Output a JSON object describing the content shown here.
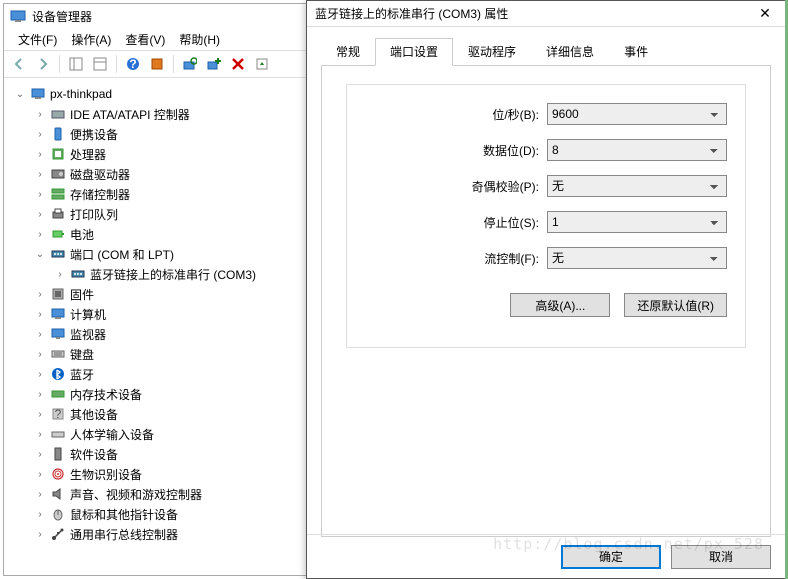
{
  "dm": {
    "title": "设备管理器",
    "menu": {
      "file": "文件(F)",
      "action": "操作(A)",
      "view": "查看(V)",
      "help": "帮助(H)"
    },
    "root": "px-thinkpad",
    "nodes": [
      {
        "label": "IDE ATA/ATAPI 控制器",
        "icon": "ide"
      },
      {
        "label": "便携设备",
        "icon": "portable"
      },
      {
        "label": "处理器",
        "icon": "cpu"
      },
      {
        "label": "磁盘驱动器",
        "icon": "disk"
      },
      {
        "label": "存储控制器",
        "icon": "storage"
      },
      {
        "label": "打印队列",
        "icon": "print"
      },
      {
        "label": "电池",
        "icon": "battery"
      },
      {
        "label": "端口 (COM 和 LPT)",
        "icon": "port",
        "expanded": true,
        "children": [
          {
            "label": "蓝牙链接上的标准串行 (COM3)",
            "icon": "port"
          }
        ]
      },
      {
        "label": "固件",
        "icon": "firmware"
      },
      {
        "label": "计算机",
        "icon": "computer"
      },
      {
        "label": "监视器",
        "icon": "monitor"
      },
      {
        "label": "键盘",
        "icon": "keyboard"
      },
      {
        "label": "蓝牙",
        "icon": "bluetooth"
      },
      {
        "label": "内存技术设备",
        "icon": "memory"
      },
      {
        "label": "其他设备",
        "icon": "other"
      },
      {
        "label": "人体学输入设备",
        "icon": "hid"
      },
      {
        "label": "软件设备",
        "icon": "soft"
      },
      {
        "label": "生物识别设备",
        "icon": "bio"
      },
      {
        "label": "声音、视频和游戏控制器",
        "icon": "audio"
      },
      {
        "label": "鼠标和其他指针设备",
        "icon": "mouse"
      },
      {
        "label": "通用串行总线控制器",
        "icon": "usb"
      }
    ]
  },
  "prop": {
    "title": "蓝牙链接上的标准串行 (COM3) 属性",
    "tabs": {
      "general": "常规",
      "port": "端口设置",
      "driver": "驱动程序",
      "details": "详细信息",
      "events": "事件"
    },
    "fields": {
      "baud_label": "位/秒(B):",
      "baud_value": "9600",
      "databits_label": "数据位(D):",
      "databits_value": "8",
      "parity_label": "奇偶校验(P):",
      "parity_value": "无",
      "stopbits_label": "停止位(S):",
      "stopbits_value": "1",
      "flow_label": "流控制(F):",
      "flow_value": "无"
    },
    "advanced": "高级(A)...",
    "restore": "还原默认值(R)",
    "ok": "确定",
    "cancel": "取消"
  },
  "watermark": "http://blog.csdn.net/px_528"
}
